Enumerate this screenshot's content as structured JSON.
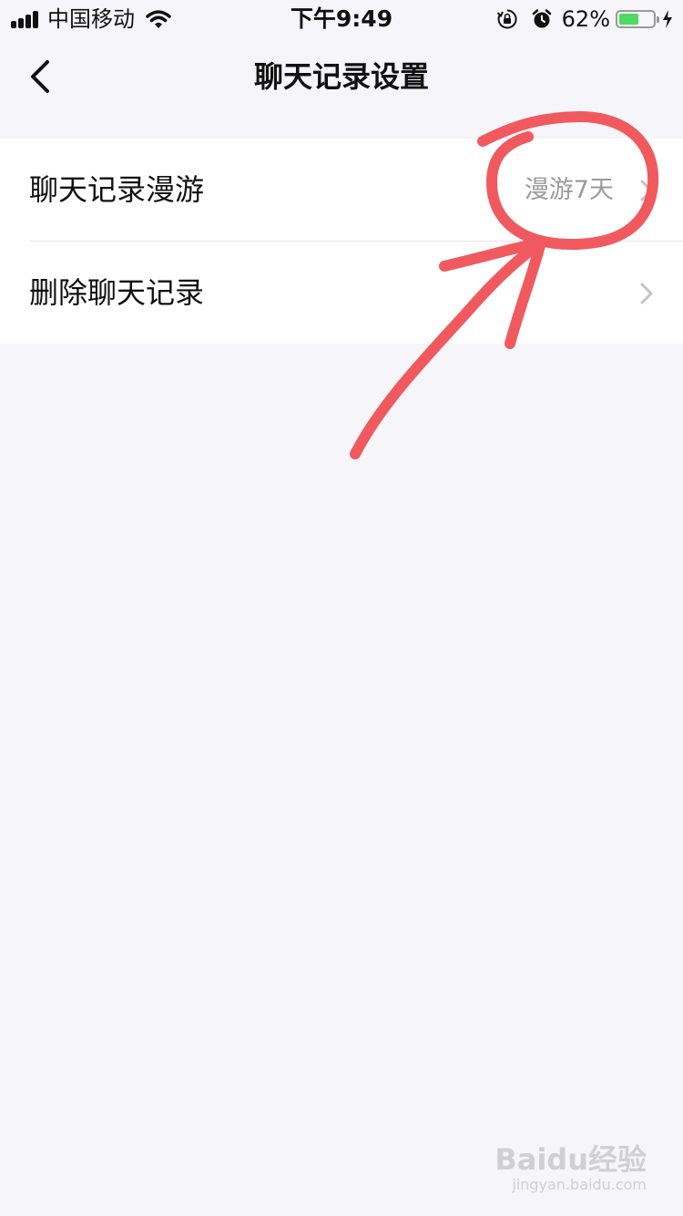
{
  "status_bar": {
    "carrier": "中国移动",
    "time": "下午9:49",
    "battery": "62%",
    "battery_level": 0.62,
    "icons": [
      "signal-icon",
      "wifi-icon",
      "orientation-lock-icon",
      "alarm-icon",
      "battery-icon",
      "charging-icon"
    ]
  },
  "nav": {
    "title": "聊天记录设置",
    "back_icon": "chevron-left-icon"
  },
  "settings": {
    "items": [
      {
        "label": "聊天记录漫游",
        "value": "漫游7天"
      },
      {
        "label": "删除聊天记录",
        "value": ""
      }
    ]
  },
  "watermark": {
    "logo": "Baidu经验",
    "url": "jingyan.baidu.com"
  },
  "colors": {
    "background": "#f5f5fa",
    "annotation": "#f05a5e",
    "secondary_text": "#9b9b9b",
    "battery_fill": "#4cd964"
  }
}
